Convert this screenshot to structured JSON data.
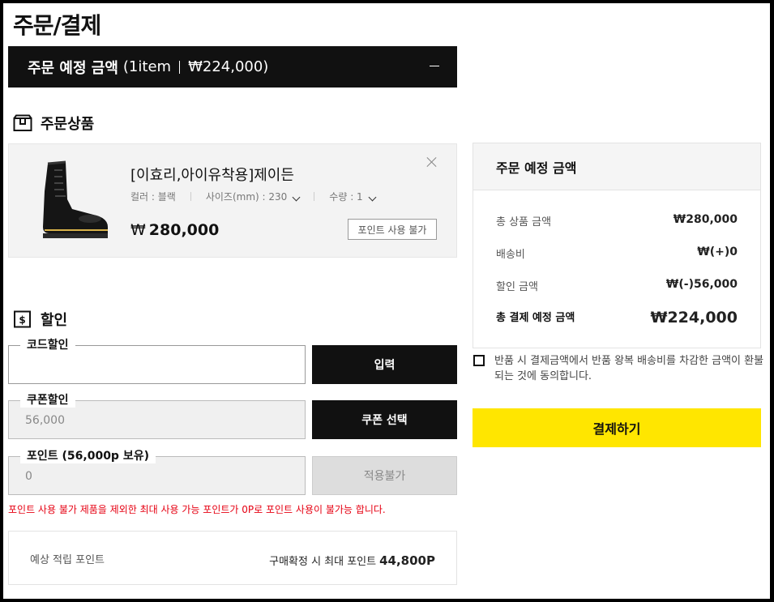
{
  "page": {
    "title": "주문/결제"
  },
  "summary_bar": {
    "label": "주문 예정 금액",
    "count": "(1item",
    "amount": "₩224,000)"
  },
  "products_section": {
    "title": "주문상품",
    "icon": "box-icon"
  },
  "product": {
    "name": "[이효리,아이유착용]제이든",
    "color": "컬러 : 블랙",
    "size": "사이즈(mm) : 230",
    "qty": "수량 : 1",
    "currency": "₩",
    "price": "280,000",
    "point_badge": "포인트 사용 불가"
  },
  "discount_section": {
    "title": "할인",
    "icon": "dollar-icon",
    "code": {
      "legend": "코드할인",
      "value": "",
      "button": "입력"
    },
    "coupon": {
      "legend": "쿠폰할인",
      "value": "56,000",
      "button": "쿠폰 선택"
    },
    "points": {
      "legend": "포인트 (56,000p 보유)",
      "value": "0",
      "button": "적용불가"
    },
    "warning": "포인트 사용 불가 제품을 제외한 최대 사용 가능 포인트가 0P로 포인트 사용이 불가능 합니다."
  },
  "earn_points": {
    "label": "예상 적립 포인트",
    "prefix": "구매확정 시 최대 포인트",
    "value": "44,800P"
  },
  "side_summary": {
    "title": "주문 예정 금액",
    "rows": [
      {
        "label": "총 상품 금액",
        "value": "₩280,000"
      },
      {
        "label": "배송비",
        "value": "₩(+)0"
      },
      {
        "label": "할인 금액",
        "value": "₩(-)56,000"
      }
    ],
    "total": {
      "label": "총 결제 예정 금액",
      "value": "₩224,000"
    }
  },
  "agreement": {
    "text": "반품 시 결제금액에서 반품 왕복 배송비를 차감한 금액이 환불되는 것에 동의합니다.",
    "checked": false
  },
  "pay_button": {
    "label": "결제하기"
  },
  "colors": {
    "accent": "#ffe600",
    "dark": "#111111",
    "warning": "#e60012"
  }
}
